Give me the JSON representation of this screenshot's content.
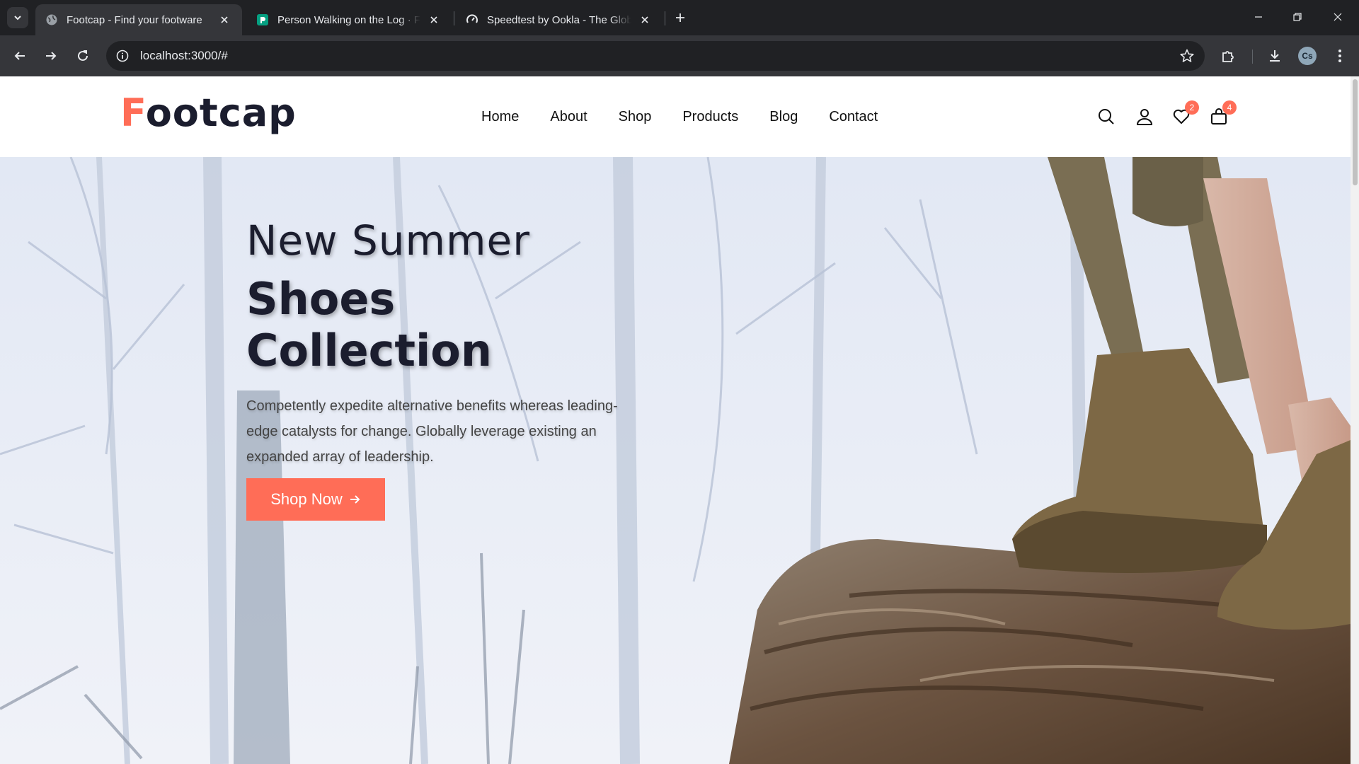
{
  "browser": {
    "tabs": [
      {
        "title": "Footcap - Find your footware",
        "active": true,
        "favicon": "globe-icon"
      },
      {
        "title": "Person Walking on the Log · Free",
        "active": false,
        "favicon": "pexels-icon"
      },
      {
        "title": "Speedtest by Ookla - The Global",
        "active": false,
        "favicon": "speedtest-icon"
      }
    ],
    "url": "localhost:3000/#",
    "profile_initials": "Cs"
  },
  "site": {
    "logo_first": "F",
    "logo_rest": "ootcap",
    "nav": [
      "Home",
      "About",
      "Shop",
      "Products",
      "Blog",
      "Contact"
    ],
    "wishlist_count": "2",
    "cart_count": "4",
    "accent_color": "#ff6d57"
  },
  "hero": {
    "subtitle": "New Summer",
    "title": "Shoes Collection",
    "text": "Competently expedite alternative benefits whereas leading-edge catalysts for change. Globally leverage existing an expanded array of leadership.",
    "button_label": "Shop Now"
  }
}
